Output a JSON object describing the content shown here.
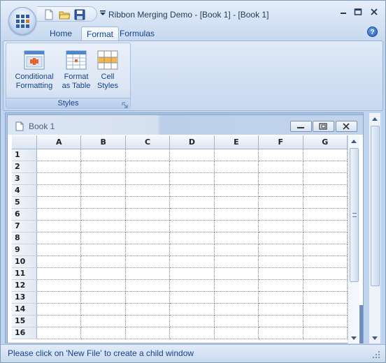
{
  "window": {
    "title": "Ribbon Merging Demo - [Book 1] - [Book 1]"
  },
  "quick_access": {
    "icons": [
      "new-file-icon",
      "open-folder-icon",
      "save-icon"
    ],
    "dropdown_icon": "qat-dropdown-icon"
  },
  "tabs": [
    {
      "label": "Home",
      "active": false
    },
    {
      "label": "Format",
      "active": true
    },
    {
      "label": "Formulas",
      "active": false
    }
  ],
  "ribbon": {
    "groups": [
      {
        "label": "Styles",
        "buttons": [
          {
            "label_line1": "Conditional",
            "label_line2": "Formatting",
            "icon": "conditional-formatting-icon"
          },
          {
            "label_line1": "Format",
            "label_line2": "as Table",
            "icon": "format-as-table-icon"
          },
          {
            "label_line1": "Cell",
            "label_line2": "Styles",
            "icon": "cell-styles-icon"
          }
        ]
      }
    ]
  },
  "child_window": {
    "title": "Book 1"
  },
  "grid": {
    "columns": [
      "A",
      "B",
      "C",
      "D",
      "E",
      "F",
      "G"
    ],
    "rows": [
      "1",
      "2",
      "3",
      "4",
      "5",
      "6",
      "7",
      "8",
      "9",
      "10",
      "11",
      "12",
      "13",
      "14",
      "15",
      "16"
    ]
  },
  "status_bar": {
    "text": "Please click on 'New File' to create a child window"
  },
  "colors": {
    "accent": "#15428b",
    "ribbon_bg": "#dfe9f6",
    "mdi_bg": "#abc3e3"
  }
}
